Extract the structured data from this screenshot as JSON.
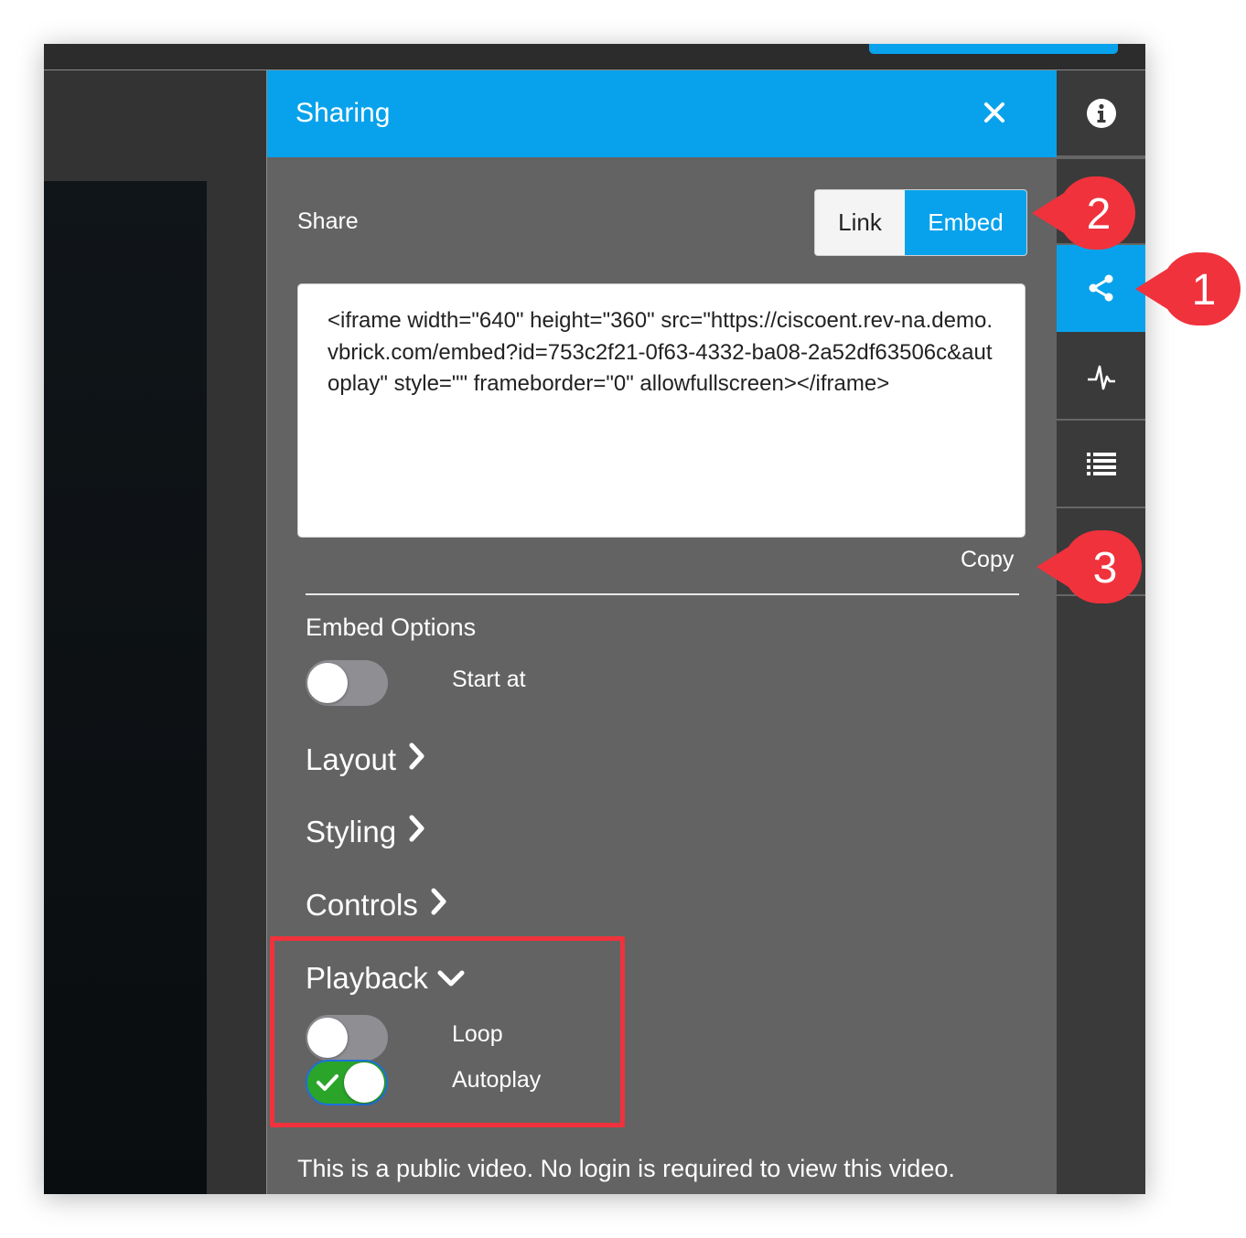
{
  "panel": {
    "title": "Sharing",
    "close_icon": "close-icon",
    "share_label": "Share",
    "share_mode": {
      "options": [
        "Link",
        "Embed"
      ],
      "selected": "Embed"
    },
    "embed_code": "<iframe width=\"640\" height=\"360\" src=\"https://ciscoent.rev-na.demo.vbrick.com/embed?id=753c2f21-0f63-4332-ba08-2a52df63506c&autoplay\" style=\"\" frameborder=\"0\" allowfullscreen></iframe>",
    "copy_label": "Copy",
    "embed_options_title": "Embed Options",
    "start_at": {
      "label": "Start at",
      "enabled": false
    },
    "sections": {
      "layout": "Layout",
      "styling": "Styling",
      "controls": "Controls",
      "playback": "Playback"
    },
    "playback": {
      "loop": {
        "label": "Loop",
        "enabled": false
      },
      "autoplay": {
        "label": "Autoplay",
        "enabled": true
      }
    },
    "public_note": "This is a public video. No login is required to view this video."
  },
  "rail": {
    "items": [
      {
        "icon": "info-icon",
        "active": false
      },
      {
        "icon": "share-icon",
        "active": true
      },
      {
        "icon": "pulse-icon",
        "active": false
      },
      {
        "icon": "list-icon",
        "active": false
      }
    ]
  },
  "callouts": {
    "share": "1",
    "embed": "2",
    "copy": "3"
  },
  "colors": {
    "accent": "#08a2ec",
    "panel_bg": "#636363",
    "toggle_on": "#2aa52a",
    "toggle_off": "#8e8e93",
    "callout": "#f0323c"
  }
}
